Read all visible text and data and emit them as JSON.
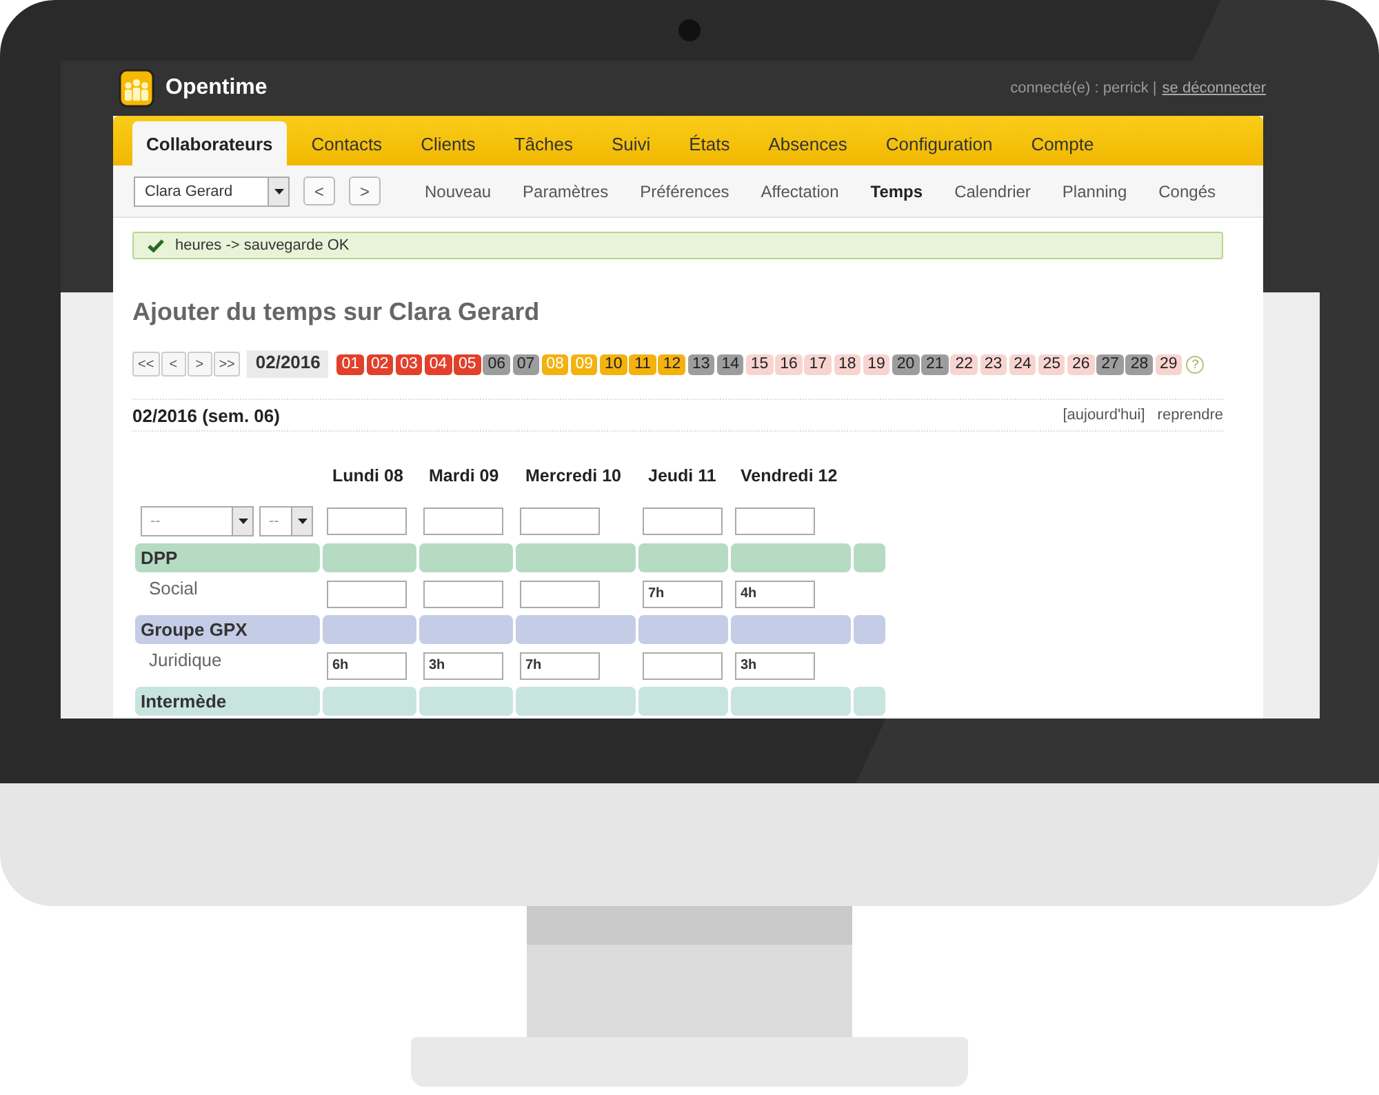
{
  "header": {
    "app_name": "Opentime",
    "user_text": "connecté(e) : perrick |",
    "logout_link": "se déconnecter"
  },
  "main_nav": [
    {
      "label": "Collaborateurs",
      "selected": true
    },
    {
      "label": "Contacts",
      "selected": false
    },
    {
      "label": "Clients",
      "selected": false
    },
    {
      "label": "Tâches",
      "selected": false
    },
    {
      "label": "Suivi",
      "selected": false
    },
    {
      "label": "États",
      "selected": false
    },
    {
      "label": "Absences",
      "selected": false
    },
    {
      "label": "Configuration",
      "selected": false
    },
    {
      "label": "Compte",
      "selected": false
    }
  ],
  "collaborator_select": {
    "value": "Clara Gerard"
  },
  "pager_buttons": [
    "<",
    ">"
  ],
  "sub_nav": [
    {
      "label": "Nouveau",
      "selected": false
    },
    {
      "label": "Paramètres",
      "selected": false
    },
    {
      "label": "Préférences",
      "selected": false
    },
    {
      "label": "Affectation",
      "selected": false
    },
    {
      "label": "Temps",
      "selected": true
    },
    {
      "label": "Calendrier",
      "selected": false
    },
    {
      "label": "Planning",
      "selected": false
    },
    {
      "label": "Congés",
      "selected": false
    }
  ],
  "message": {
    "text": "heures -> sauvegarde OK"
  },
  "page_title": "Ajouter du temps sur Clara Gerard",
  "month_nav": {
    "buttons": [
      "<<",
      "<",
      ">",
      ">>"
    ],
    "month": "02/2016",
    "help": "?",
    "days": [
      {
        "label": "01",
        "kind": "absence"
      },
      {
        "label": "02",
        "kind": "absence"
      },
      {
        "label": "03",
        "kind": "absence"
      },
      {
        "label": "04",
        "kind": "absence"
      },
      {
        "label": "05",
        "kind": "absence"
      },
      {
        "label": "06",
        "kind": "weekend"
      },
      {
        "label": "07",
        "kind": "weekend"
      },
      {
        "label": "08",
        "kind": "partial"
      },
      {
        "label": "09",
        "kind": "partial"
      },
      {
        "label": "10",
        "kind": "filled"
      },
      {
        "label": "11",
        "kind": "filled"
      },
      {
        "label": "12",
        "kind": "filled"
      },
      {
        "label": "13",
        "kind": "weekend"
      },
      {
        "label": "14",
        "kind": "weekend"
      },
      {
        "label": "15",
        "kind": "empty"
      },
      {
        "label": "16",
        "kind": "empty"
      },
      {
        "label": "17",
        "kind": "empty"
      },
      {
        "label": "18",
        "kind": "empty"
      },
      {
        "label": "19",
        "kind": "empty"
      },
      {
        "label": "20",
        "kind": "weekend"
      },
      {
        "label": "21",
        "kind": "weekend"
      },
      {
        "label": "22",
        "kind": "empty"
      },
      {
        "label": "23",
        "kind": "empty"
      },
      {
        "label": "24",
        "kind": "empty"
      },
      {
        "label": "25",
        "kind": "empty"
      },
      {
        "label": "26",
        "kind": "empty"
      },
      {
        "label": "27",
        "kind": "weekend"
      },
      {
        "label": "28",
        "kind": "weekend"
      },
      {
        "label": "29",
        "kind": "empty"
      }
    ]
  },
  "week": {
    "title": "02/2016 (sem. 06)",
    "links": [
      "[aujourd'hui]",
      "reprendre"
    ]
  },
  "table": {
    "columns": [
      "Lundi 08",
      "Mardi 09",
      "Mercredi 10",
      "Jeudi 11",
      "Vendredi 12"
    ],
    "filter_selects": [
      "--",
      "--"
    ],
    "groups": [
      {
        "name": "DPP",
        "color": "#b5dbc3",
        "rows": [
          {
            "label": "Social",
            "cells": [
              null,
              null,
              null,
              "7h",
              "4h"
            ]
          }
        ]
      },
      {
        "name": "Groupe GPX",
        "color": "#c5cce6",
        "rows": [
          {
            "label": "Juridique",
            "cells": [
              "6h",
              "3h",
              "7h",
              null,
              "3h"
            ]
          }
        ]
      },
      {
        "name": "Intermède",
        "color": "#c8e4df"
      }
    ]
  }
}
